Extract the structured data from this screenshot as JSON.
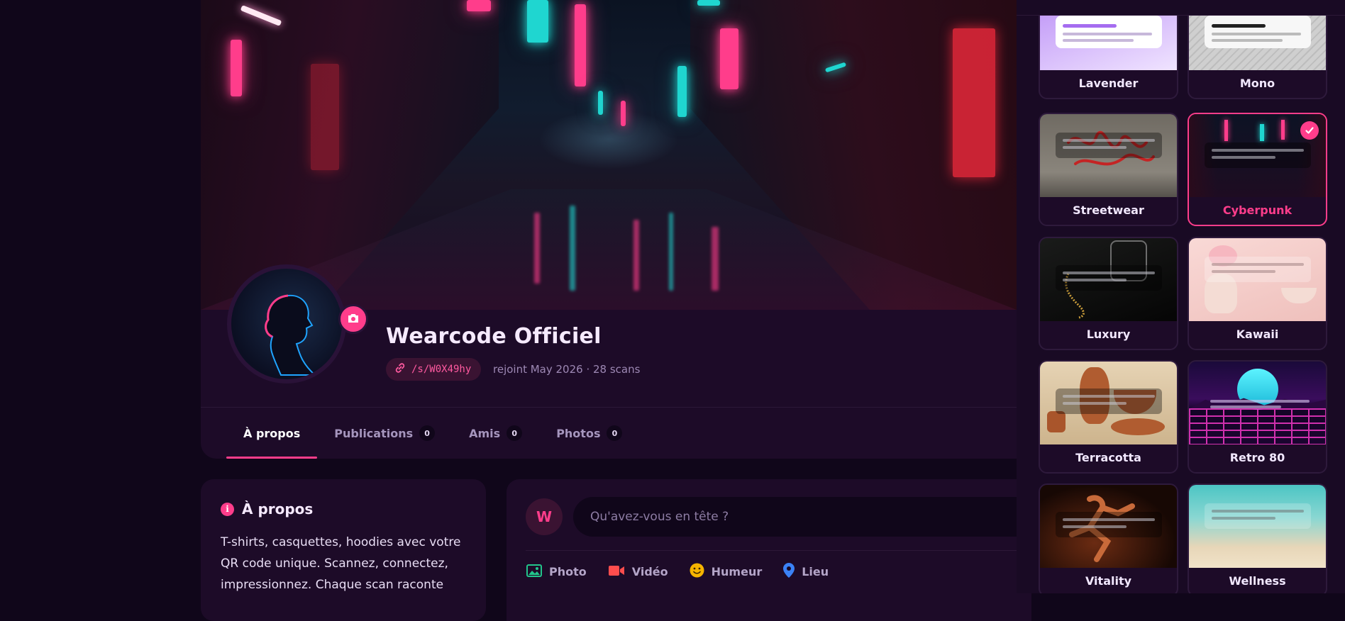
{
  "profile": {
    "name": "Wearcode Officiel",
    "slug": "/s/W0X49hy",
    "meta": "rejoint May 2026 · 28 scans"
  },
  "tabs": [
    {
      "label": "À propos",
      "count": null,
      "active": true
    },
    {
      "label": "Publications",
      "count": "0",
      "active": false
    },
    {
      "label": "Amis",
      "count": "0",
      "active": false
    },
    {
      "label": "Photos",
      "count": "0",
      "active": false
    }
  ],
  "about": {
    "title": "À propos",
    "text": "T-shirts, casquettes, hoodies avec votre QR code unique. Scannez, connectez, impressionnez. Chaque scan raconte"
  },
  "composer": {
    "avatar_letter": "W",
    "placeholder": "Qu'avez-vous en tête ?",
    "actions": [
      {
        "label": "Photo",
        "icon": "image-icon",
        "color": "#22c58b"
      },
      {
        "label": "Vidéo",
        "icon": "video-icon",
        "color": "#ff4d4d"
      },
      {
        "label": "Humeur",
        "icon": "smile-icon",
        "color": "#f5b400"
      },
      {
        "label": "Lieu",
        "icon": "location-pin-icon",
        "color": "#3b82f6"
      }
    ]
  },
  "themes": [
    {
      "label": "Lavender",
      "selected": false
    },
    {
      "label": "Mono",
      "selected": false
    },
    {
      "label": "Streetwear",
      "selected": false
    },
    {
      "label": "Cyberpunk",
      "selected": true
    },
    {
      "label": "Luxury",
      "selected": false
    },
    {
      "label": "Kawaii",
      "selected": false
    },
    {
      "label": "Terracotta",
      "selected": false
    },
    {
      "label": "Retro 80",
      "selected": false
    },
    {
      "label": "Vitality",
      "selected": false
    },
    {
      "label": "Wellness",
      "selected": false
    }
  ],
  "colors": {
    "accent": "#ff3d8b",
    "background": "#10061a",
    "card": "#1d0b28"
  }
}
